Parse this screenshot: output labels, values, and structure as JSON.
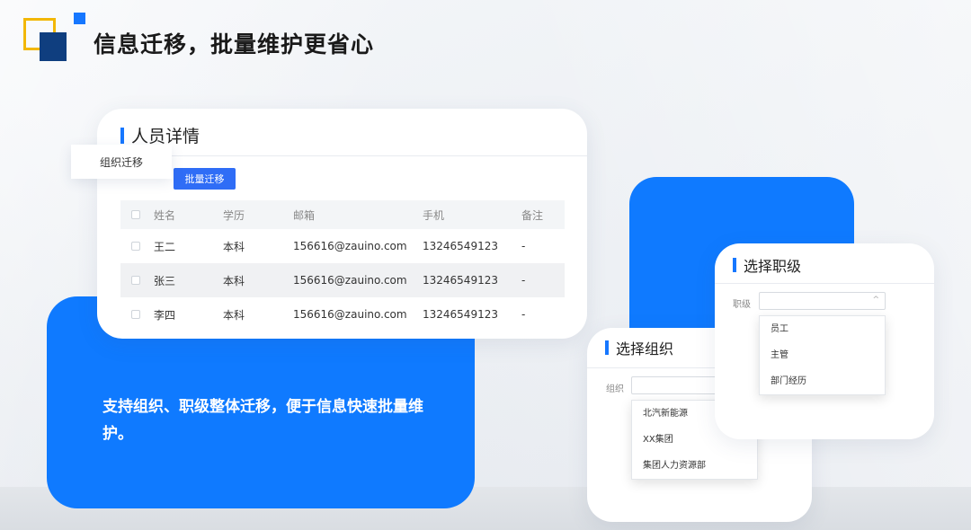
{
  "page_title": "信息迁移，批量维护更省心",
  "description": "支持组织、职级整体迁移，便于信息快速批量维护。",
  "colors": {
    "accent": "#1677ff",
    "blue_card": "#0f7aff",
    "logo_yellow": "#f2b705",
    "logo_dark": "#0f3e7f"
  },
  "person_panel": {
    "title": "人员详情",
    "tab_label": "组织迁移",
    "batch_button": "批量迁移",
    "columns": [
      "姓名",
      "学历",
      "邮箱",
      "手机",
      "备注"
    ],
    "rows": [
      {
        "name": "王二",
        "edu": "本科",
        "email": "156616@zauino.com",
        "phone": "13246549123",
        "note": "-"
      },
      {
        "name": "张三",
        "edu": "本科",
        "email": "156616@zauino.com",
        "phone": "13246549123",
        "note": "-"
      },
      {
        "name": "李四",
        "edu": "本科",
        "email": "156616@zauino.com",
        "phone": "13246549123",
        "note": "-"
      }
    ]
  },
  "org_panel": {
    "title": "选择组织",
    "field_label": "组织",
    "options": [
      "北汽新能源",
      "XX集团",
      "集团人力资源部"
    ]
  },
  "level_panel": {
    "title": "选择职级",
    "field_label": "职级",
    "options": [
      "员工",
      "主管",
      "部门经历"
    ]
  }
}
